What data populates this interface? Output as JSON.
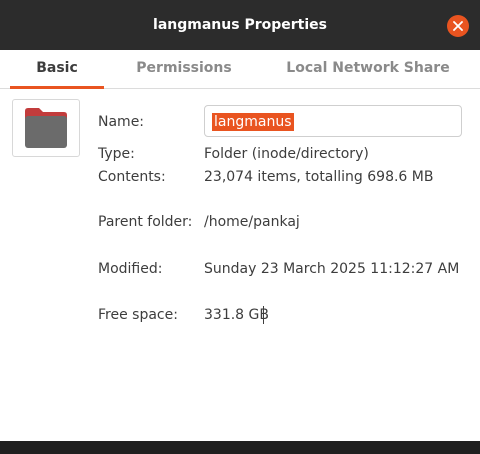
{
  "window": {
    "title": "langmanus Properties"
  },
  "tabs": [
    {
      "label": "Basic",
      "active": true
    },
    {
      "label": "Permissions",
      "active": false
    },
    {
      "label": "Local Network Share",
      "active": false
    }
  ],
  "icons": {
    "folder": "folder-icon",
    "close": "close-icon"
  },
  "colors": {
    "accent": "#e95420",
    "titlebar": "#2c2c2c",
    "folder_body": "#6b6b6b",
    "folder_tab": "#c23c3c"
  },
  "fields": {
    "name": {
      "label": "Name:",
      "value": "langmanus"
    },
    "type": {
      "label": "Type:",
      "value": "Folder (inode/directory)"
    },
    "contents": {
      "label": "Contents:",
      "value": "23,074 items, totalling 698.6 MB"
    },
    "parent": {
      "label": "Parent folder:",
      "value": "/home/pankaj"
    },
    "modified": {
      "label": "Modified:",
      "value": "Sunday 23 March 2025 11:12:27 AM"
    },
    "free_space": {
      "label": "Free space:",
      "value": "331.8 GB"
    }
  }
}
